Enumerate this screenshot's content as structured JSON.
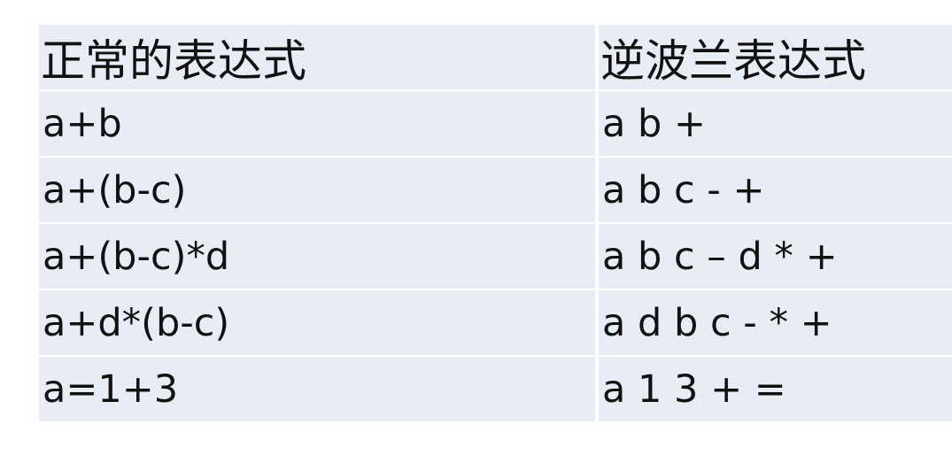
{
  "table": {
    "headers": [
      "正常的表达式",
      "逆波兰表达式"
    ],
    "rows": [
      [
        "a+b",
        "a b +"
      ],
      [
        "a+(b-c)",
        "a b c - +"
      ],
      [
        "a+(b-c)*d",
        "a b c – d * +"
      ],
      [
        "a+d*(b-c)",
        "a d b c - * +"
      ],
      [
        "a=1+3",
        "a 1 3 + ="
      ]
    ]
  }
}
